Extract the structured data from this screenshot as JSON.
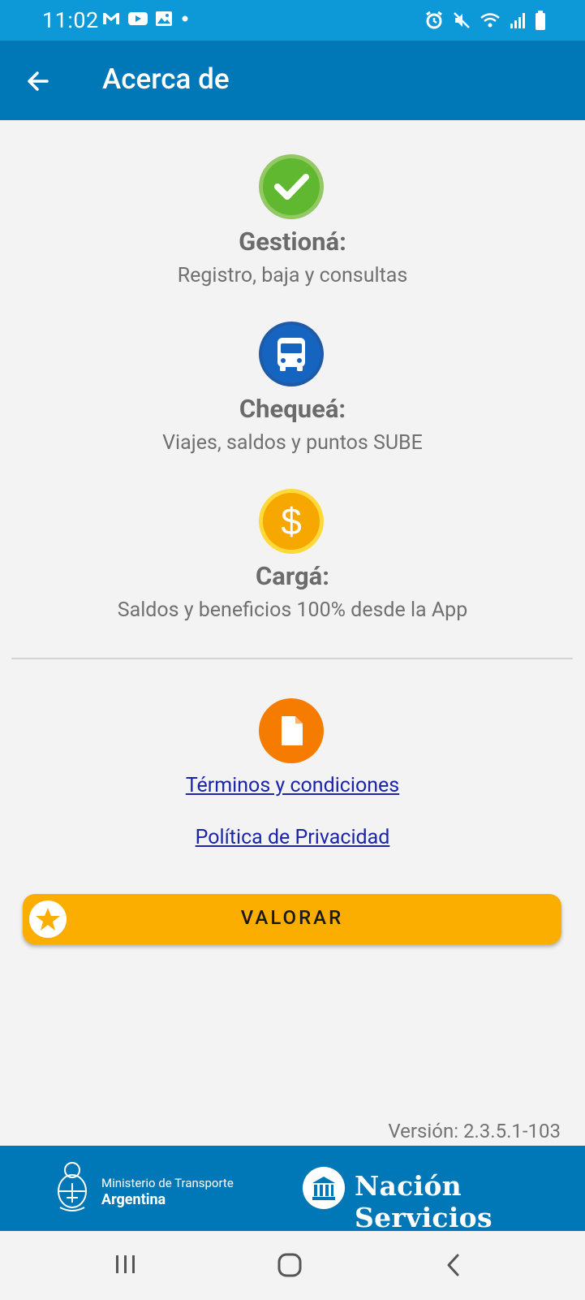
{
  "status_bar": {
    "time": "11:02",
    "left_icons": [
      "gmail-icon",
      "youtube-icon",
      "gallery-icon",
      "dot-icon"
    ],
    "right_icons": [
      "alarm-icon",
      "mute-icon",
      "wifi-icon",
      "signal-icon",
      "battery-icon"
    ]
  },
  "app_bar": {
    "title": "Acerca de",
    "back_icon": "arrow-left-icon"
  },
  "features": [
    {
      "icon": "check-icon",
      "color": "#5fb82f",
      "title": "Gestioná:",
      "description": "Registro, baja y consultas"
    },
    {
      "icon": "bus-icon",
      "color": "#1565c0",
      "title": "Chequeá:",
      "description": "Viajes, saldos y puntos SUBE"
    },
    {
      "icon": "dollar-icon",
      "color": "#f6a700",
      "title": "Cargá:",
      "description": "Saldos y beneficios 100% desde la App"
    }
  ],
  "legal": {
    "icon": "document-icon",
    "icon_color": "#f57c00",
    "terms_label": "Términos y condiciones",
    "privacy_label": "Política de Privacidad"
  },
  "rate_button": {
    "label": "VALORAR",
    "icon": "star-icon",
    "color": "#fbad00"
  },
  "version": "Versión: 2.3.5.1-103",
  "footer": {
    "ministry_line1": "Ministerio de Transporte",
    "ministry_line2": "Argentina",
    "brand": "Nación Servicios"
  },
  "nav_bar": {
    "icons": [
      "recent-apps-icon",
      "home-icon",
      "back-icon"
    ]
  },
  "colors": {
    "status_bar": "#0d98d8",
    "app_bar": "#0078b7",
    "background": "#f3f3f3",
    "link": "#1a25a8"
  }
}
